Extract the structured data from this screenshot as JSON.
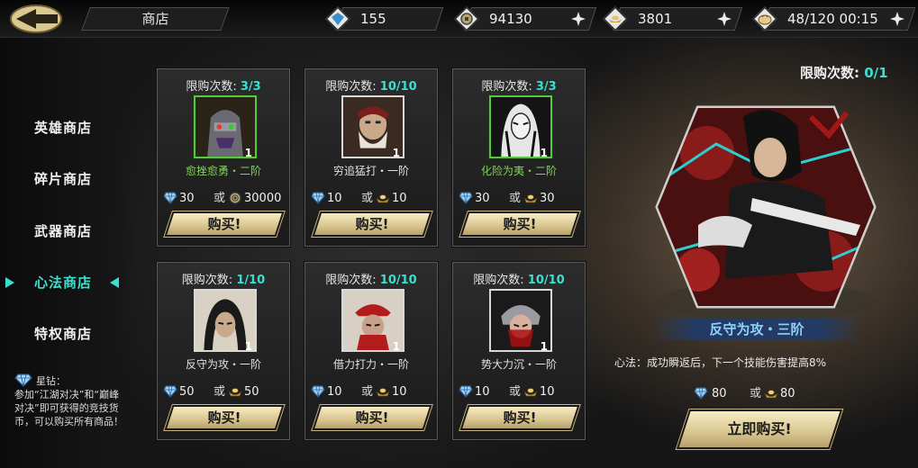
{
  "header": {
    "title": "商店"
  },
  "resources": [
    {
      "name": "diamond",
      "icon": "diamond-icon",
      "value": "155",
      "plus": false
    },
    {
      "name": "coin",
      "icon": "coin-icon",
      "value": "94130",
      "plus": true
    },
    {
      "name": "ingot",
      "icon": "ingot-icon",
      "value": "3801",
      "plus": true
    },
    {
      "name": "stamina",
      "icon": "bun-icon",
      "value": "48/120 00:15",
      "plus": true
    }
  ],
  "sidebar": {
    "items": [
      {
        "label": "英雄商店"
      },
      {
        "label": "碎片商店"
      },
      {
        "label": "武器商店"
      },
      {
        "label": "心法商店",
        "active": true
      },
      {
        "label": "特权商店"
      }
    ],
    "note_label": "星钻：",
    "note_text": "参加“江湖对决”和“巅峰对决”即可获得的竞技货币，可以购买所有商品！"
  },
  "cards": [
    {
      "limit_label": "限购次数:",
      "limit": "3/3",
      "name": "愈挫愈勇・二阶",
      "green": true,
      "qty": "1",
      "price1": "30",
      "or": "或",
      "price2": "30000",
      "price2_icon": "coin-icon",
      "buy": "购买!"
    },
    {
      "limit_label": "限购次数:",
      "limit": "10/10",
      "name": "穷追猛打・一阶",
      "green": false,
      "qty": "1",
      "price1": "10",
      "or": "或",
      "price2": "10",
      "price2_icon": "ingot-icon",
      "buy": "购买!"
    },
    {
      "limit_label": "限购次数:",
      "limit": "3/3",
      "name": "化险为夷・二阶",
      "green": true,
      "qty": "1",
      "price1": "30",
      "or": "或",
      "price2": "30",
      "price2_icon": "ingot-icon",
      "buy": "购买!"
    },
    {
      "limit_label": "限购次数:",
      "limit": "1/10",
      "name": "反守为攻・一阶",
      "green": false,
      "qty": "1",
      "price1": "50",
      "or": "或",
      "price2": "50",
      "price2_icon": "ingot-icon",
      "buy": "购买!"
    },
    {
      "limit_label": "限购次数:",
      "limit": "10/10",
      "name": "借力打力・一阶",
      "green": false,
      "qty": "1",
      "price1": "10",
      "or": "或",
      "price2": "10",
      "price2_icon": "ingot-icon",
      "buy": "购买!"
    },
    {
      "limit_label": "限购次数:",
      "limit": "10/10",
      "name": "势大力沉・一阶",
      "green": false,
      "qty": "1",
      "price1": "10",
      "or": "或",
      "price2": "10",
      "price2_icon": "ingot-icon",
      "buy": "购买!"
    }
  ],
  "featured": {
    "limit_label": "限购次数:",
    "limit": "0/1",
    "name": "反守为攻・三阶",
    "desc": "心法：成功瞬返后，下一个技能伤害提高8%",
    "price1": "80",
    "or": "或",
    "price2": "80",
    "buy": "立即购买!"
  },
  "colors": {
    "accent": "#39e0d0",
    "gold": "#d8c58e",
    "green": "#56c840"
  }
}
